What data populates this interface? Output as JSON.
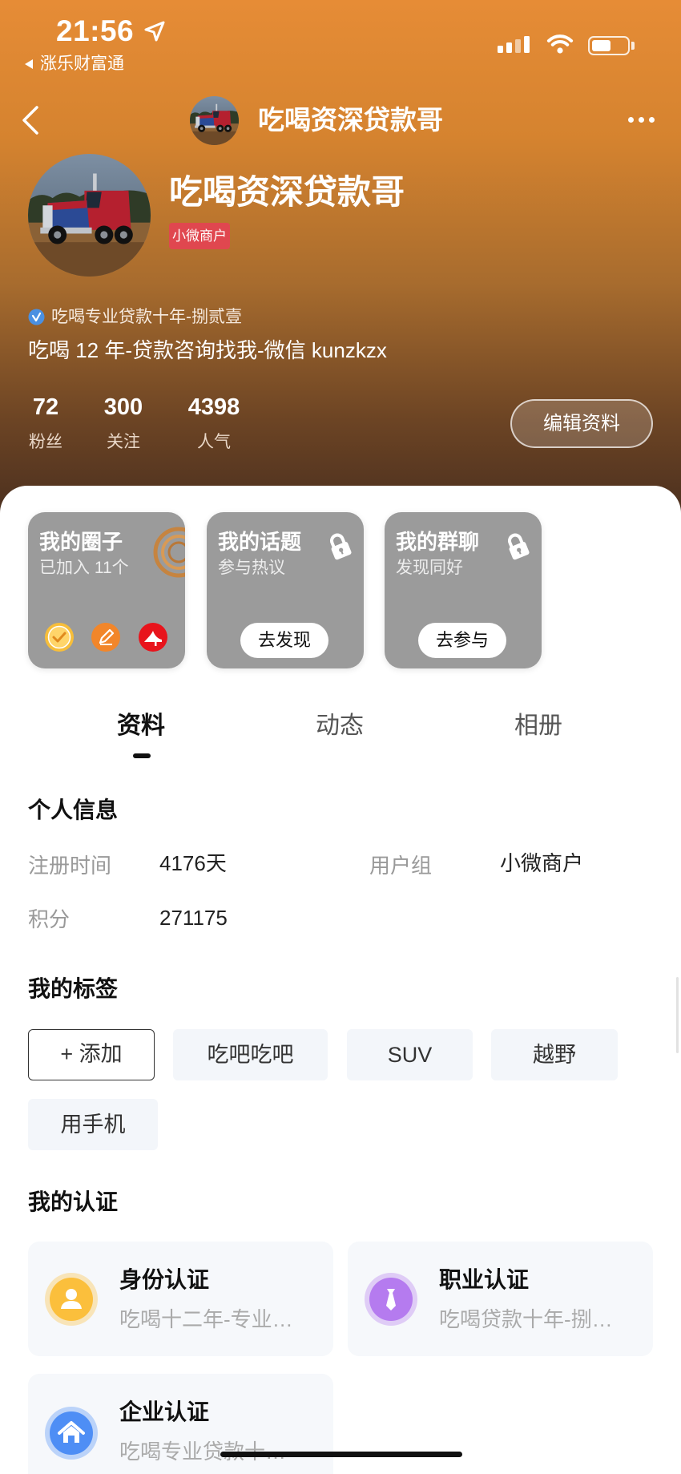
{
  "status_bar": {
    "time": "21:56",
    "back_app_label": "涨乐财富通",
    "battery_level": 0.55
  },
  "nav": {
    "title": "吃喝资深贷款哥"
  },
  "profile": {
    "name": "吃喝资深贷款哥",
    "badge": "小微商户",
    "verified_text": "吃喝专业贷款十年-捌贰壹",
    "bio": "吃喝 12 年-贷款咨询找我-微信 kunzkzx",
    "stats": [
      {
        "value": "72",
        "label": "粉丝"
      },
      {
        "value": "300",
        "label": "关注"
      },
      {
        "value": "4398",
        "label": "人气"
      }
    ],
    "edit_button": "编辑资料"
  },
  "feature_cards": [
    {
      "title": "我的圈子",
      "subtitle": "已加入 11个",
      "icons": [
        "check-icon",
        "pen-icon",
        "high-heel-icon"
      ]
    },
    {
      "title": "我的话题",
      "subtitle": "参与热议",
      "button": "去发现",
      "locked": true
    },
    {
      "title": "我的群聊",
      "subtitle": "发现同好",
      "button": "去参与",
      "locked": true
    }
  ],
  "tabs": [
    {
      "label": "资料",
      "active": true
    },
    {
      "label": "动态",
      "active": false
    },
    {
      "label": "相册",
      "active": false
    }
  ],
  "personal_info": {
    "heading": "个人信息",
    "fields": [
      {
        "label": "注册时间",
        "value": "4176天"
      },
      {
        "label": "用户组",
        "value": "小微商户"
      },
      {
        "label": "积分",
        "value": "271175"
      }
    ]
  },
  "tags": {
    "heading": "我的标签",
    "add_label": "+ 添加",
    "items": [
      "吃吧吃吧",
      "SUV",
      "越野",
      "用手机"
    ]
  },
  "certifications": {
    "heading": "我的认证",
    "items": [
      {
        "title": "身份认证",
        "desc": "吃喝十二年-专业…",
        "icon": "person-icon",
        "color": "#FBBF3C"
      },
      {
        "title": "职业认证",
        "desc": "吃喝贷款十年-捌…",
        "icon": "tie-icon",
        "color": "#B57BEF"
      },
      {
        "title": "企业认证",
        "desc": "吃喝专业贷款十…",
        "icon": "house-icon",
        "color": "#4E8EF5"
      }
    ]
  },
  "colors": {
    "header_top": "#E68C36",
    "header_bottom": "#4C301F",
    "badge": "#E0474F",
    "card_gray": "#9B9B9B",
    "verified_blue": "#4A90E2"
  }
}
